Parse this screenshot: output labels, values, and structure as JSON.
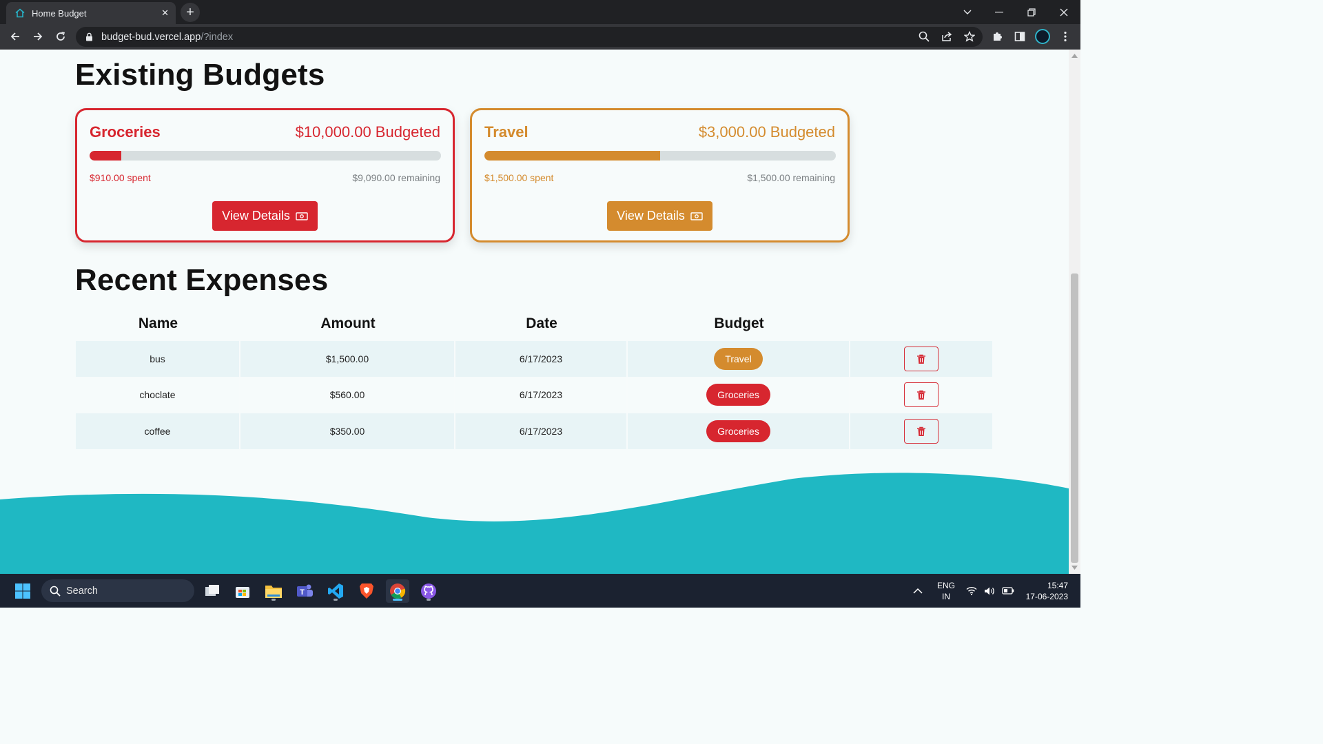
{
  "browser": {
    "tab_title": "Home Budget",
    "url_host": "budget-bud.vercel.app",
    "url_path": "/?index"
  },
  "page": {
    "budgets_heading": "Existing Budgets",
    "expenses_heading": "Recent Expenses",
    "budgets": [
      {
        "name": "Groceries",
        "budgeted": "$10,000.00 Budgeted",
        "spent": "$910.00 spent",
        "remaining": "$9,090.00 remaining",
        "progress": 0.091,
        "color": "#d7262f",
        "button": "View Details"
      },
      {
        "name": "Travel",
        "budgeted": "$3,000.00 Budgeted",
        "spent": "$1,500.00 spent",
        "remaining": "$1,500.00 remaining",
        "progress": 0.5,
        "color": "#d48b2e",
        "button": "View Details"
      }
    ],
    "table": {
      "headers": [
        "Name",
        "Amount",
        "Date",
        "Budget"
      ],
      "rows": [
        {
          "name": "bus",
          "amount": "$1,500.00",
          "date": "6/17/2023",
          "budget": "Travel",
          "budget_color": "#d48b2e"
        },
        {
          "name": "choclate",
          "amount": "$560.00",
          "date": "6/17/2023",
          "budget": "Groceries",
          "budget_color": "#d7262f"
        },
        {
          "name": "coffee",
          "amount": "$350.00",
          "date": "6/17/2023",
          "budget": "Groceries",
          "budget_color": "#d7262f"
        }
      ]
    },
    "wave_color": "#1fb8c3"
  },
  "taskbar": {
    "search_label": "Search",
    "lang_line1": "ENG",
    "lang_line2": "IN",
    "time": "15:47",
    "date": "17-06-2023"
  }
}
